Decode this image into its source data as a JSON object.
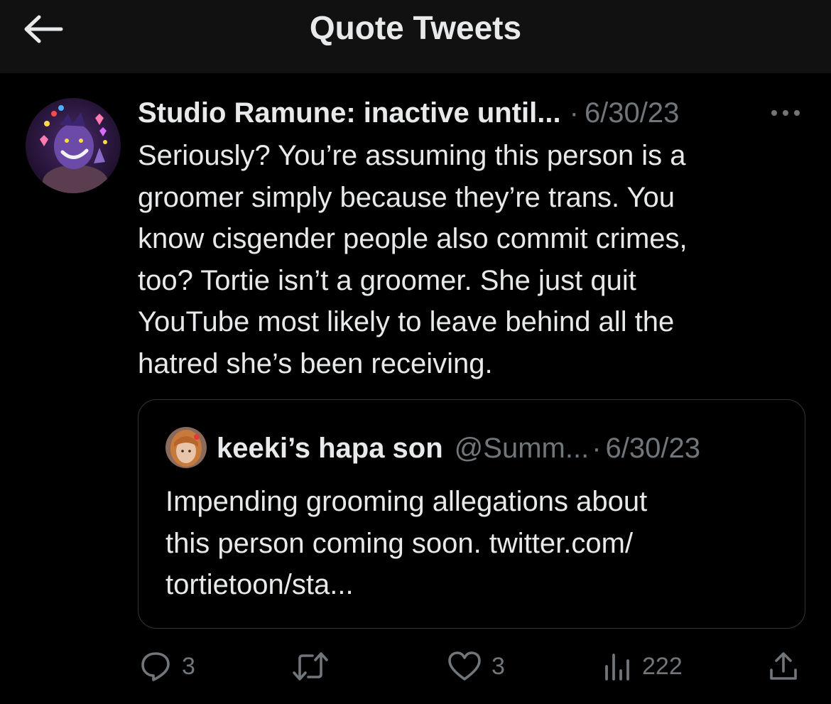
{
  "header": {
    "title": "Quote Tweets",
    "back_icon": "arrow-left-icon"
  },
  "tweet": {
    "author_name": "Studio Ramune: inactive until...",
    "separator": "·",
    "date": "6/30/23",
    "more_icon": "more-horizontal-icon",
    "body": "Seriously? You’re assuming this person is a\ngroomer simply because they’re trans. You\nknow cisgender people also commit crimes,\ntoo? Tortie isn’t a groomer. She just quit\nYouTube most likely to leave behind all the\nhatred she’s been receiving.",
    "quote": {
      "author_name": "keeki’s hapa son",
      "handle": "@Summ...",
      "separator": "·",
      "date": "6/30/23",
      "body": "Impending grooming allegations about\nthis person coming soon. twitter.com/\ntortietoon/sta..."
    },
    "actions": {
      "reply": {
        "icon": "reply-icon",
        "count": "3"
      },
      "retweet": {
        "icon": "retweet-icon"
      },
      "like": {
        "icon": "heart-icon",
        "count": "3"
      },
      "views": {
        "icon": "views-chart-icon",
        "count": "222"
      },
      "share": {
        "icon": "share-icon"
      }
    }
  },
  "colors": {
    "background": "#000000",
    "header_background": "#111111",
    "text_primary": "#e7e9ea",
    "text_secondary": "#71767b",
    "border": "#333639"
  }
}
